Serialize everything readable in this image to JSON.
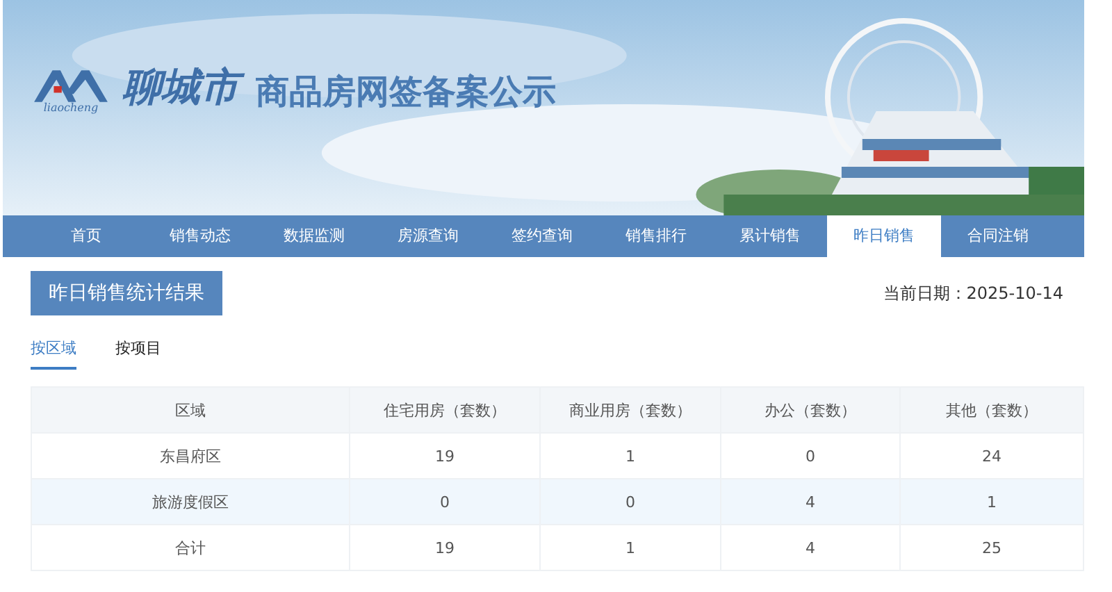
{
  "banner": {
    "logo_text": "liaocheng",
    "city": "聊城市",
    "title": "商品房网签备案公示"
  },
  "nav": [
    {
      "label": "首页",
      "selected": false
    },
    {
      "label": "销售动态",
      "selected": false
    },
    {
      "label": "数据监测",
      "selected": false
    },
    {
      "label": "房源查询",
      "selected": false
    },
    {
      "label": "签约查询",
      "selected": false
    },
    {
      "label": "销售排行",
      "selected": false
    },
    {
      "label": "累计销售",
      "selected": false
    },
    {
      "label": "昨日销售",
      "selected": true
    },
    {
      "label": "合同注销",
      "selected": false
    }
  ],
  "heading": "昨日销售统计结果",
  "date": "当前日期：2025-10-14",
  "tabs": [
    {
      "label": "按区域",
      "selected": true
    },
    {
      "label": "按项目",
      "selected": false
    }
  ],
  "table": {
    "columns": [
      "区域",
      "住宅用房（套数）",
      "商业用房（套数）",
      "办公（套数）",
      "其他（套数）"
    ],
    "rows": [
      [
        "东昌府区",
        "19",
        "1",
        "0",
        "24"
      ],
      [
        "旅游度假区",
        "0",
        "0",
        "4",
        "1"
      ],
      [
        "合计",
        "19",
        "1",
        "4",
        "25"
      ]
    ]
  }
}
